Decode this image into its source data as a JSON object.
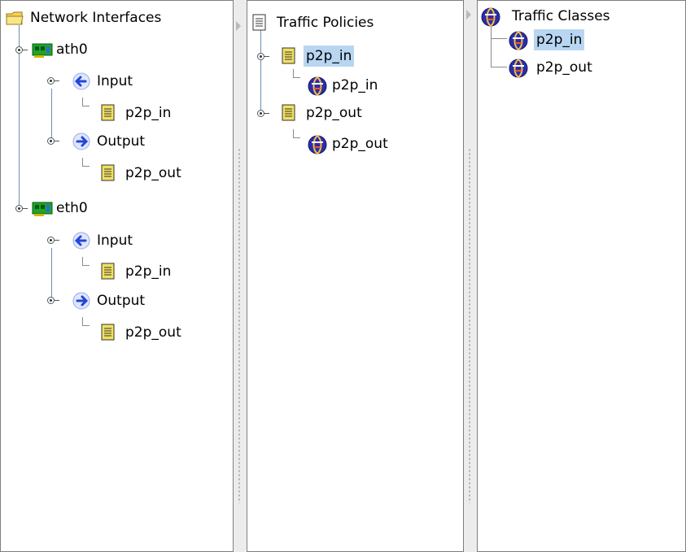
{
  "interfaces_pane": {
    "root": "Network Interfaces",
    "ath0": {
      "label": "ath0",
      "input_label": "Input",
      "input_policy": "p2p_in",
      "output_label": "Output",
      "output_policy": "p2p_out"
    },
    "eth0": {
      "label": "eth0",
      "input_label": "Input",
      "input_policy": "p2p_in",
      "output_label": "Output",
      "output_policy": "p2p_out"
    }
  },
  "policies_pane": {
    "root": "Traffic Policies",
    "policy_in": {
      "label": "p2p_in",
      "class_label": "p2p_in"
    },
    "policy_out": {
      "label": "p2p_out",
      "class_label": "p2p_out"
    }
  },
  "classes_pane": {
    "root": "Traffic Classes",
    "class_in": "p2p_in",
    "class_out": "p2p_out"
  },
  "colors": {
    "selection": "#b8d6f2",
    "tree_line": "#6a8fb3",
    "arrow_blue": "#2346d8",
    "nic_green": "#1fa32a",
    "document_yellow": "#f0e060"
  },
  "icons": {
    "root_interfaces": "folder-icon",
    "interface": "network-card-icon",
    "input": "arrow-left-icon",
    "output": "arrow-right-icon",
    "policy": "document-icon",
    "class": "globe-icon"
  }
}
